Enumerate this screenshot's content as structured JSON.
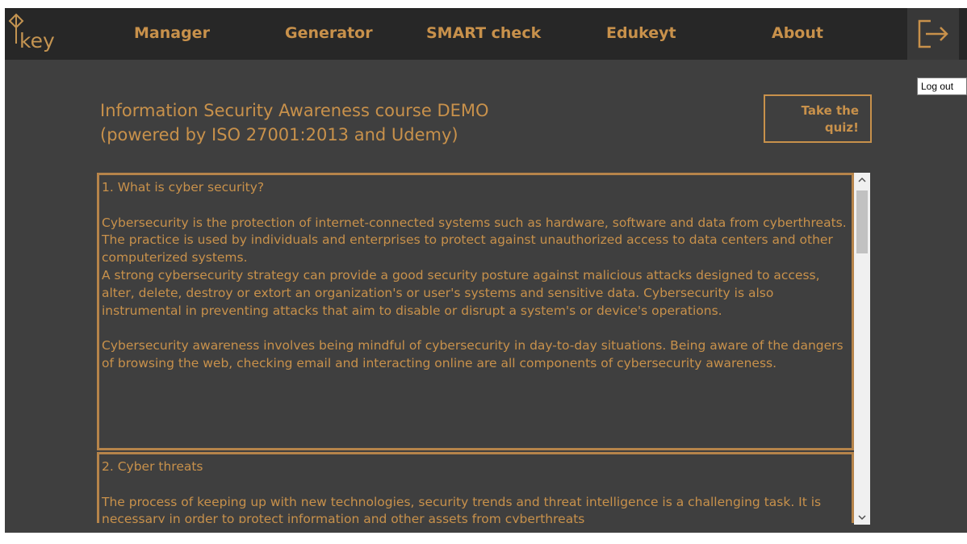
{
  "nav": {
    "logo_text": "key",
    "items": [
      {
        "label": "Manager"
      },
      {
        "label": "Generator"
      },
      {
        "label": "SMART check"
      },
      {
        "label": "Edukeyt"
      },
      {
        "label": "About"
      }
    ],
    "logout_icon": "logout-icon",
    "logout_tooltip": "Log out"
  },
  "main": {
    "title": "Information Security Awareness course DEMO\n(powered by ISO 27001:2013 and Udemy)",
    "quiz_button": "Take the\nquiz!"
  },
  "sections": [
    {
      "heading": "1. What is cyber security?",
      "paragraphs": [
        "Cybersecurity is the protection of internet-connected systems such as hardware, software and data from cyberthreats. The practice is used by individuals and enterprises to protect against unauthorized access to data centers and other computerized systems.",
        "A strong cybersecurity strategy can provide a good security posture against malicious attacks designed to access, alter, delete, destroy or extort an organization's or user's systems and sensitive data. Cybersecurity is also instrumental in preventing attacks that aim to disable or disrupt a system's or device's operations.",
        "Cybersecurity awareness involves being mindful of cybersecurity in day-to-day situations. Being aware of the dangers of browsing the web, checking email and interacting online are all components of cybersecurity awareness."
      ]
    },
    {
      "heading": "2. Cyber threats",
      "paragraphs": [
        "The process of keeping up with new technologies, security trends and threat intelligence is a challenging task. It is necessary in order to protect information and other assets from cyberthreats"
      ]
    }
  ],
  "colors": {
    "accent": "#c8914b",
    "background": "#3f3f3f",
    "navbar": "#272727"
  }
}
